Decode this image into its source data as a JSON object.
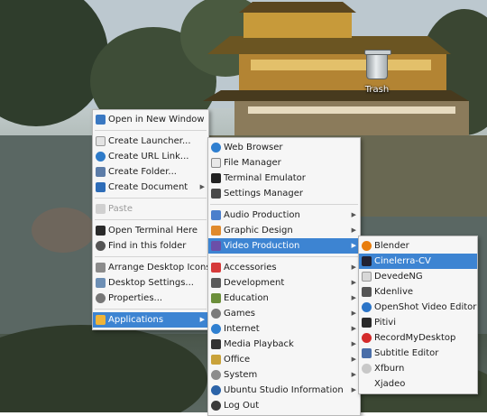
{
  "desktop": {
    "trash_label": "Trash"
  },
  "context_menu": {
    "items": [
      {
        "label": "Open in New Window",
        "icon": "window-icon"
      },
      {
        "label": "Create Launcher...",
        "icon": "launcher-icon"
      },
      {
        "label": "Create URL Link...",
        "icon": "globe-icon"
      },
      {
        "label": "Create Folder...",
        "icon": "folder-icon"
      },
      {
        "label": "Create Document",
        "icon": "document-icon"
      },
      {
        "label": "Paste",
        "icon": "paste-icon"
      },
      {
        "label": "Open Terminal Here",
        "icon": "terminal-icon"
      },
      {
        "label": "Find in this folder",
        "icon": "search-icon"
      },
      {
        "label": "Arrange Desktop Icons",
        "icon": "arrange-icon"
      },
      {
        "label": "Desktop Settings...",
        "icon": "desktop-settings-icon"
      },
      {
        "label": "Properties...",
        "icon": "properties-icon"
      },
      {
        "label": "Applications",
        "icon": "applications-icon"
      }
    ]
  },
  "applications_menu": {
    "items": [
      {
        "label": "Web Browser"
      },
      {
        "label": "File Manager"
      },
      {
        "label": "Terminal Emulator"
      },
      {
        "label": "Settings Manager"
      },
      {
        "label": "Audio Production"
      },
      {
        "label": "Graphic Design"
      },
      {
        "label": "Video Production"
      },
      {
        "label": "Accessories"
      },
      {
        "label": "Development"
      },
      {
        "label": "Education"
      },
      {
        "label": "Games"
      },
      {
        "label": "Internet"
      },
      {
        "label": "Media Playback"
      },
      {
        "label": "Office"
      },
      {
        "label": "System"
      },
      {
        "label": "Ubuntu Studio Information"
      },
      {
        "label": "Log Out"
      }
    ]
  },
  "video_menu": {
    "items": [
      {
        "label": "Blender"
      },
      {
        "label": "Cinelerra-CV"
      },
      {
        "label": "DevedeNG"
      },
      {
        "label": "Kdenlive"
      },
      {
        "label": "OpenShot Video Editor"
      },
      {
        "label": "Pitivi"
      },
      {
        "label": "RecordMyDesktop"
      },
      {
        "label": "Subtitle Editor"
      },
      {
        "label": "Xfburn"
      },
      {
        "label": "Xjadeo"
      }
    ]
  },
  "colors": {
    "highlight": "#3d84d2",
    "menu_bg": "#f6f6f6"
  }
}
